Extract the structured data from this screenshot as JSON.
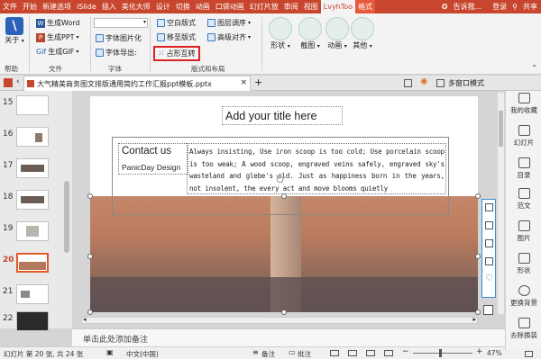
{
  "menubar": {
    "tabs": [
      "文件",
      "开始",
      "新建选项",
      "iSlide",
      "插入",
      "美化大师",
      "设计",
      "切换",
      "动画",
      "口袋动画",
      "幻灯片放",
      "审阅",
      "视图",
      "LvyhToo",
      "格式"
    ],
    "search_placeholder": "告诉我...",
    "login": "登录",
    "share": "共享"
  },
  "ribbon": {
    "help_group": {
      "button": "关于",
      "label": "帮助"
    },
    "file_group": {
      "items": [
        "生成Word",
        "生成PPT",
        "生成GIF"
      ],
      "label": "文件",
      "gif_prefix": "Gif"
    },
    "font_group": {
      "items": [
        "字体图片化",
        "字体导出:"
      ],
      "label": "字体"
    },
    "layout_group": {
      "items": [
        "空白版式",
        "移至版式",
        "占形互转"
      ],
      "right_items": [
        "图层调序",
        "高级对齐"
      ],
      "label": "版式和布局"
    },
    "big_buttons": [
      "形状",
      "截图",
      "动画",
      "其他"
    ]
  },
  "doc_tab": {
    "title": "大气精美商务图文排版通用简约工作汇报ppt模板.pptx",
    "multi_window": "多窗口模式"
  },
  "thumbnails": [
    "15",
    "16",
    "17",
    "18",
    "19",
    "20",
    "21",
    "22"
  ],
  "slide": {
    "title": "Add your title here",
    "contact_heading": "Contact us",
    "contact_sub": "PanicDay Design",
    "body": "Always insisting, Use iron scoop is too cold; Use porcelain scoop is too weak; A wood scoop, engraved veins safely, engraved sky's wasteland and glebe's old. Just as happiness born in the years, not insolent, the every act and move blooms quietly"
  },
  "notes_placeholder": "单击此处添加备注",
  "rightpane": [
    "我的收藏",
    "幻灯片",
    "目录",
    "范文",
    "图片",
    "形状",
    "更换背景",
    "去除换装"
  ],
  "statusbar": {
    "slide_info": "幻灯片 第 20 张, 共 24 张",
    "language": "中文(中国)",
    "notes": "备注",
    "comments": "批注",
    "zoom": "47%"
  },
  "colors": {
    "accent": "#c8462d",
    "ribbon_bg": "#f3f3f3",
    "highlight_box": "#e02020"
  }
}
